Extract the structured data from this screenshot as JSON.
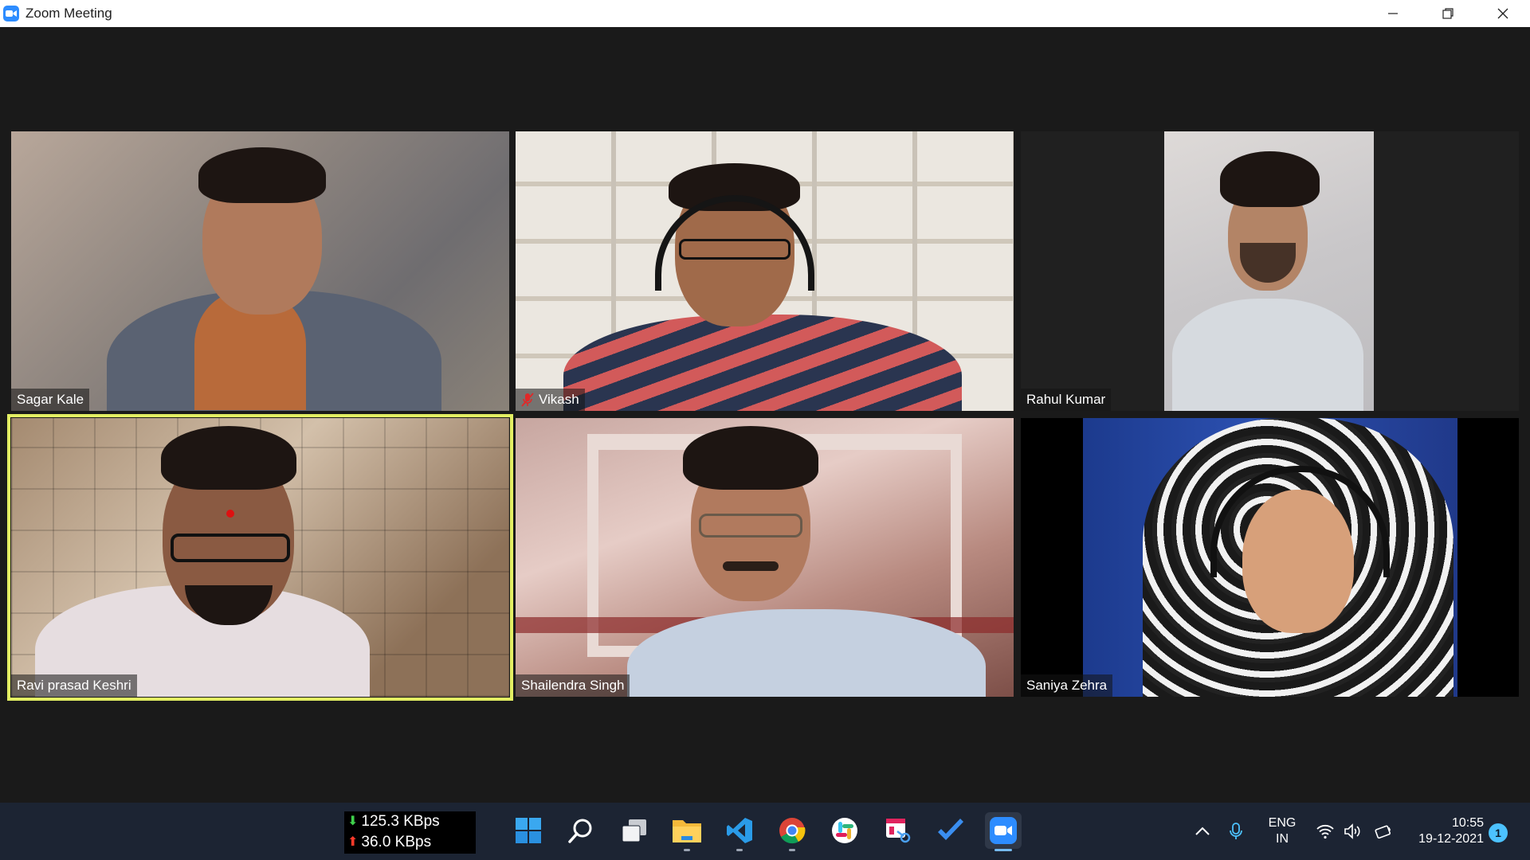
{
  "window": {
    "title": "Zoom Meeting",
    "controls": [
      "minimize-icon",
      "restore-icon",
      "close-icon"
    ]
  },
  "participants": [
    {
      "name": "Sagar Kale",
      "muted": false
    },
    {
      "name": "Vikash",
      "muted": true
    },
    {
      "name": "Rahul Kumar",
      "muted": false
    },
    {
      "name": "Ravi prasad Keshri",
      "muted": false,
      "active_speaker": true
    },
    {
      "name": "Shailendra Singh",
      "muted": false
    },
    {
      "name": "Saniya Zehra",
      "muted": false
    }
  ],
  "taskbar": {
    "netspeed": {
      "download": "125.3 KBps",
      "upload": "36.0 KBps"
    },
    "apps": [
      "start-icon",
      "search-icon",
      "task-view-icon",
      "file-explorer-icon",
      "vscode-icon",
      "chrome-icon",
      "slack-icon",
      "snipping-tool-icon",
      "todo-icon",
      "zoom-icon"
    ],
    "tray": {
      "language_line1": "ENG",
      "language_line2": "IN",
      "time": "10:55",
      "date": "19-12-2021",
      "notification_count": "1"
    }
  },
  "colors": {
    "active_speaker_border": "#e3ef63",
    "zoom_blue": "#2d8cff",
    "taskbar": "#1c2433"
  }
}
